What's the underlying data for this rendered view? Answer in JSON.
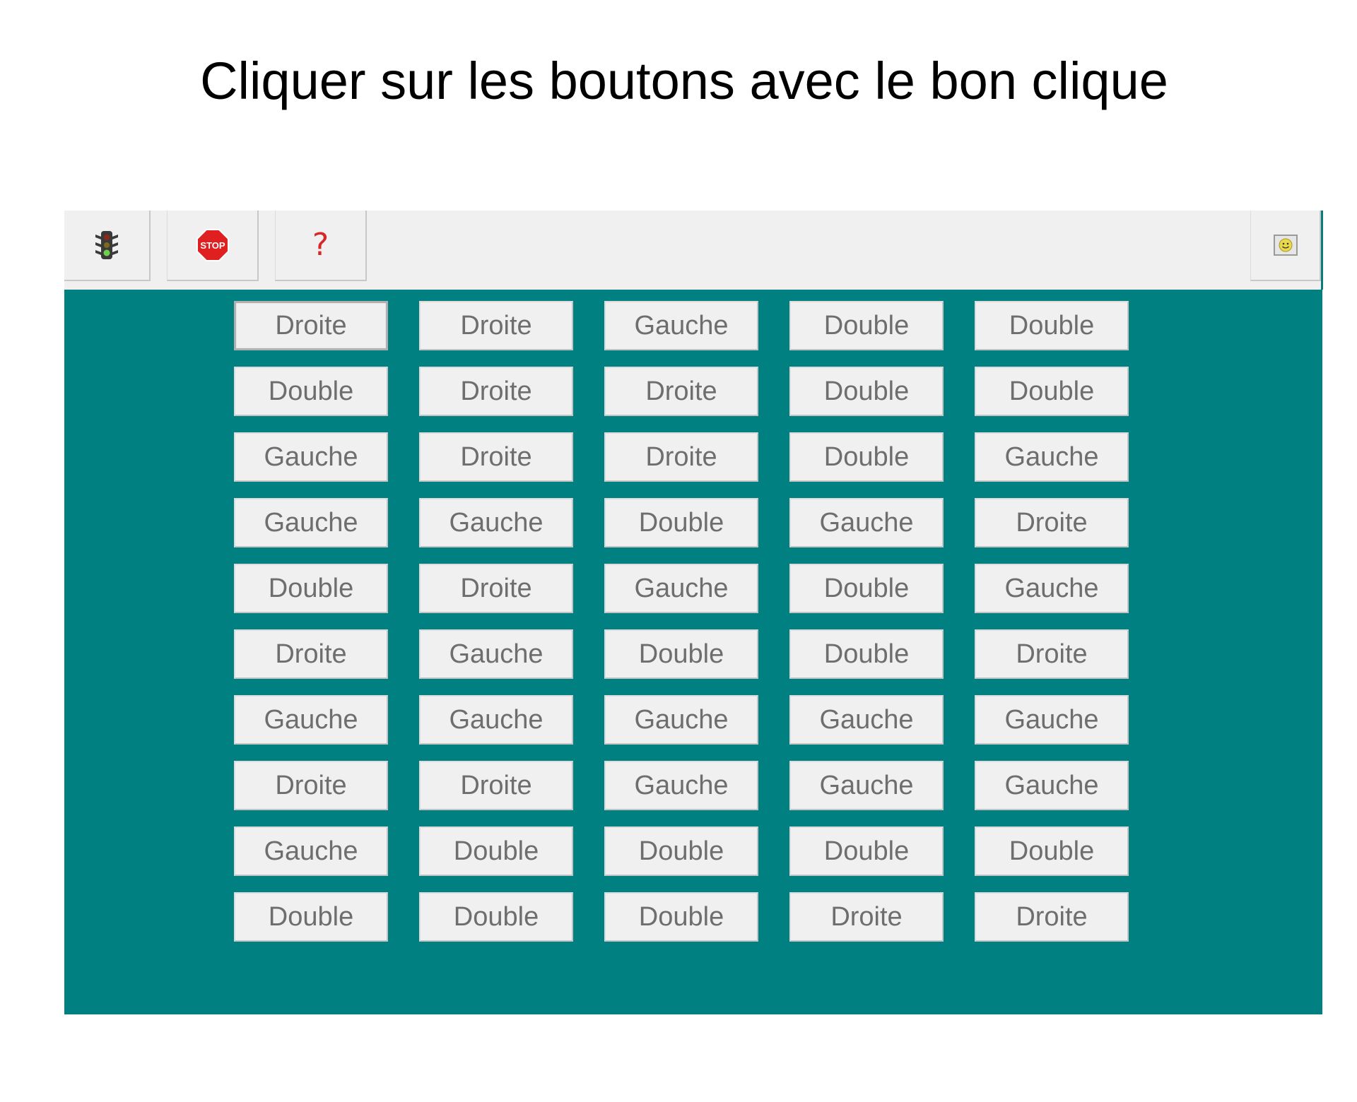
{
  "title": "Cliquer sur les boutons avec le bon clique",
  "toolbar": {
    "help_label": "?",
    "stop_label": "STOP",
    "colors": {
      "board": "#008080",
      "toolbar": "#f0f0f0",
      "stop": "#e02020",
      "help": "#d62828"
    }
  },
  "grid": [
    [
      "Droite",
      "Droite",
      "Gauche",
      "Double",
      "Double"
    ],
    [
      "Double",
      "Droite",
      "Droite",
      "Double",
      "Double"
    ],
    [
      "Gauche",
      "Droite",
      "Droite",
      "Double",
      "Gauche"
    ],
    [
      "Gauche",
      "Gauche",
      "Double",
      "Gauche",
      "Droite"
    ],
    [
      "Double",
      "Droite",
      "Gauche",
      "Double",
      "Gauche"
    ],
    [
      "Droite",
      "Gauche",
      "Double",
      "Double",
      "Droite"
    ],
    [
      "Gauche",
      "Gauche",
      "Gauche",
      "Gauche",
      "Gauche"
    ],
    [
      "Droite",
      "Droite",
      "Gauche",
      "Gauche",
      "Gauche"
    ],
    [
      "Gauche",
      "Double",
      "Double",
      "Double",
      "Double"
    ],
    [
      "Double",
      "Double",
      "Double",
      "Droite",
      "Droite"
    ]
  ]
}
